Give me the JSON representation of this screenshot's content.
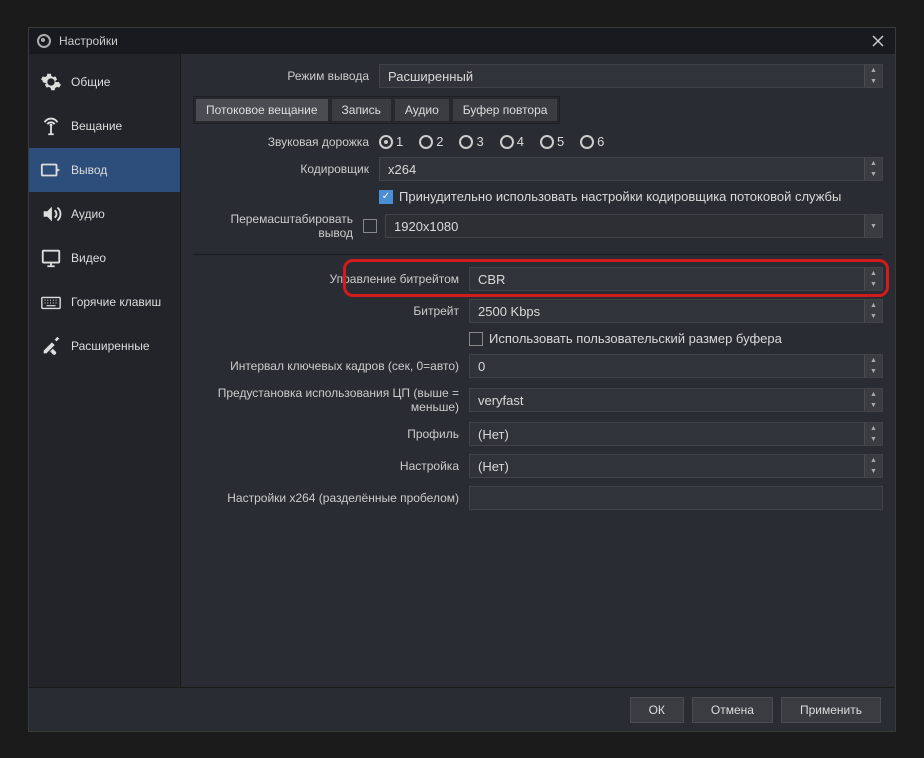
{
  "window": {
    "title": "Настройки"
  },
  "sidebar": {
    "items": [
      {
        "label": "Общие"
      },
      {
        "label": "Вещание"
      },
      {
        "label": "Вывод"
      },
      {
        "label": "Аудио"
      },
      {
        "label": "Видео"
      },
      {
        "label": "Горячие клавиш"
      },
      {
        "label": "Расширенные"
      }
    ]
  },
  "main": {
    "output_mode_label": "Режим вывода",
    "output_mode_value": "Расширенный",
    "tabs": [
      "Потоковое вещание",
      "Запись",
      "Аудио",
      "Буфер повтора"
    ],
    "audio_track_label": "Звуковая дорожка",
    "audio_tracks": [
      "1",
      "2",
      "3",
      "4",
      "5",
      "6"
    ],
    "encoder_label": "Кодировщик",
    "encoder_value": "x264",
    "enforce_label": "Принудительно использовать настройки кодировщика потоковой службы",
    "rescale_label": "Перемасштабировать вывод",
    "rescale_value": "1920x1080",
    "rate_control_label": "Управление битрейтом",
    "rate_control_value": "CBR",
    "bitrate_label": "Битрейт",
    "bitrate_value": "2500 Kbps",
    "custom_buffer_label": "Использовать пользовательский размер буфера",
    "keyframe_label": "Интервал ключевых кадров (сек, 0=авто)",
    "keyframe_value": "0",
    "cpu_preset_label": "Предустановка использования ЦП (выше = меньше)",
    "cpu_preset_value": "veryfast",
    "profile_label": "Профиль",
    "profile_value": "(Нет)",
    "tune_label": "Настройка",
    "tune_value": "(Нет)",
    "x264opts_label": "Настройки x264 (разделённые пробелом)"
  },
  "buttons": {
    "ok": "ОК",
    "cancel": "Отмена",
    "apply": "Применить"
  }
}
